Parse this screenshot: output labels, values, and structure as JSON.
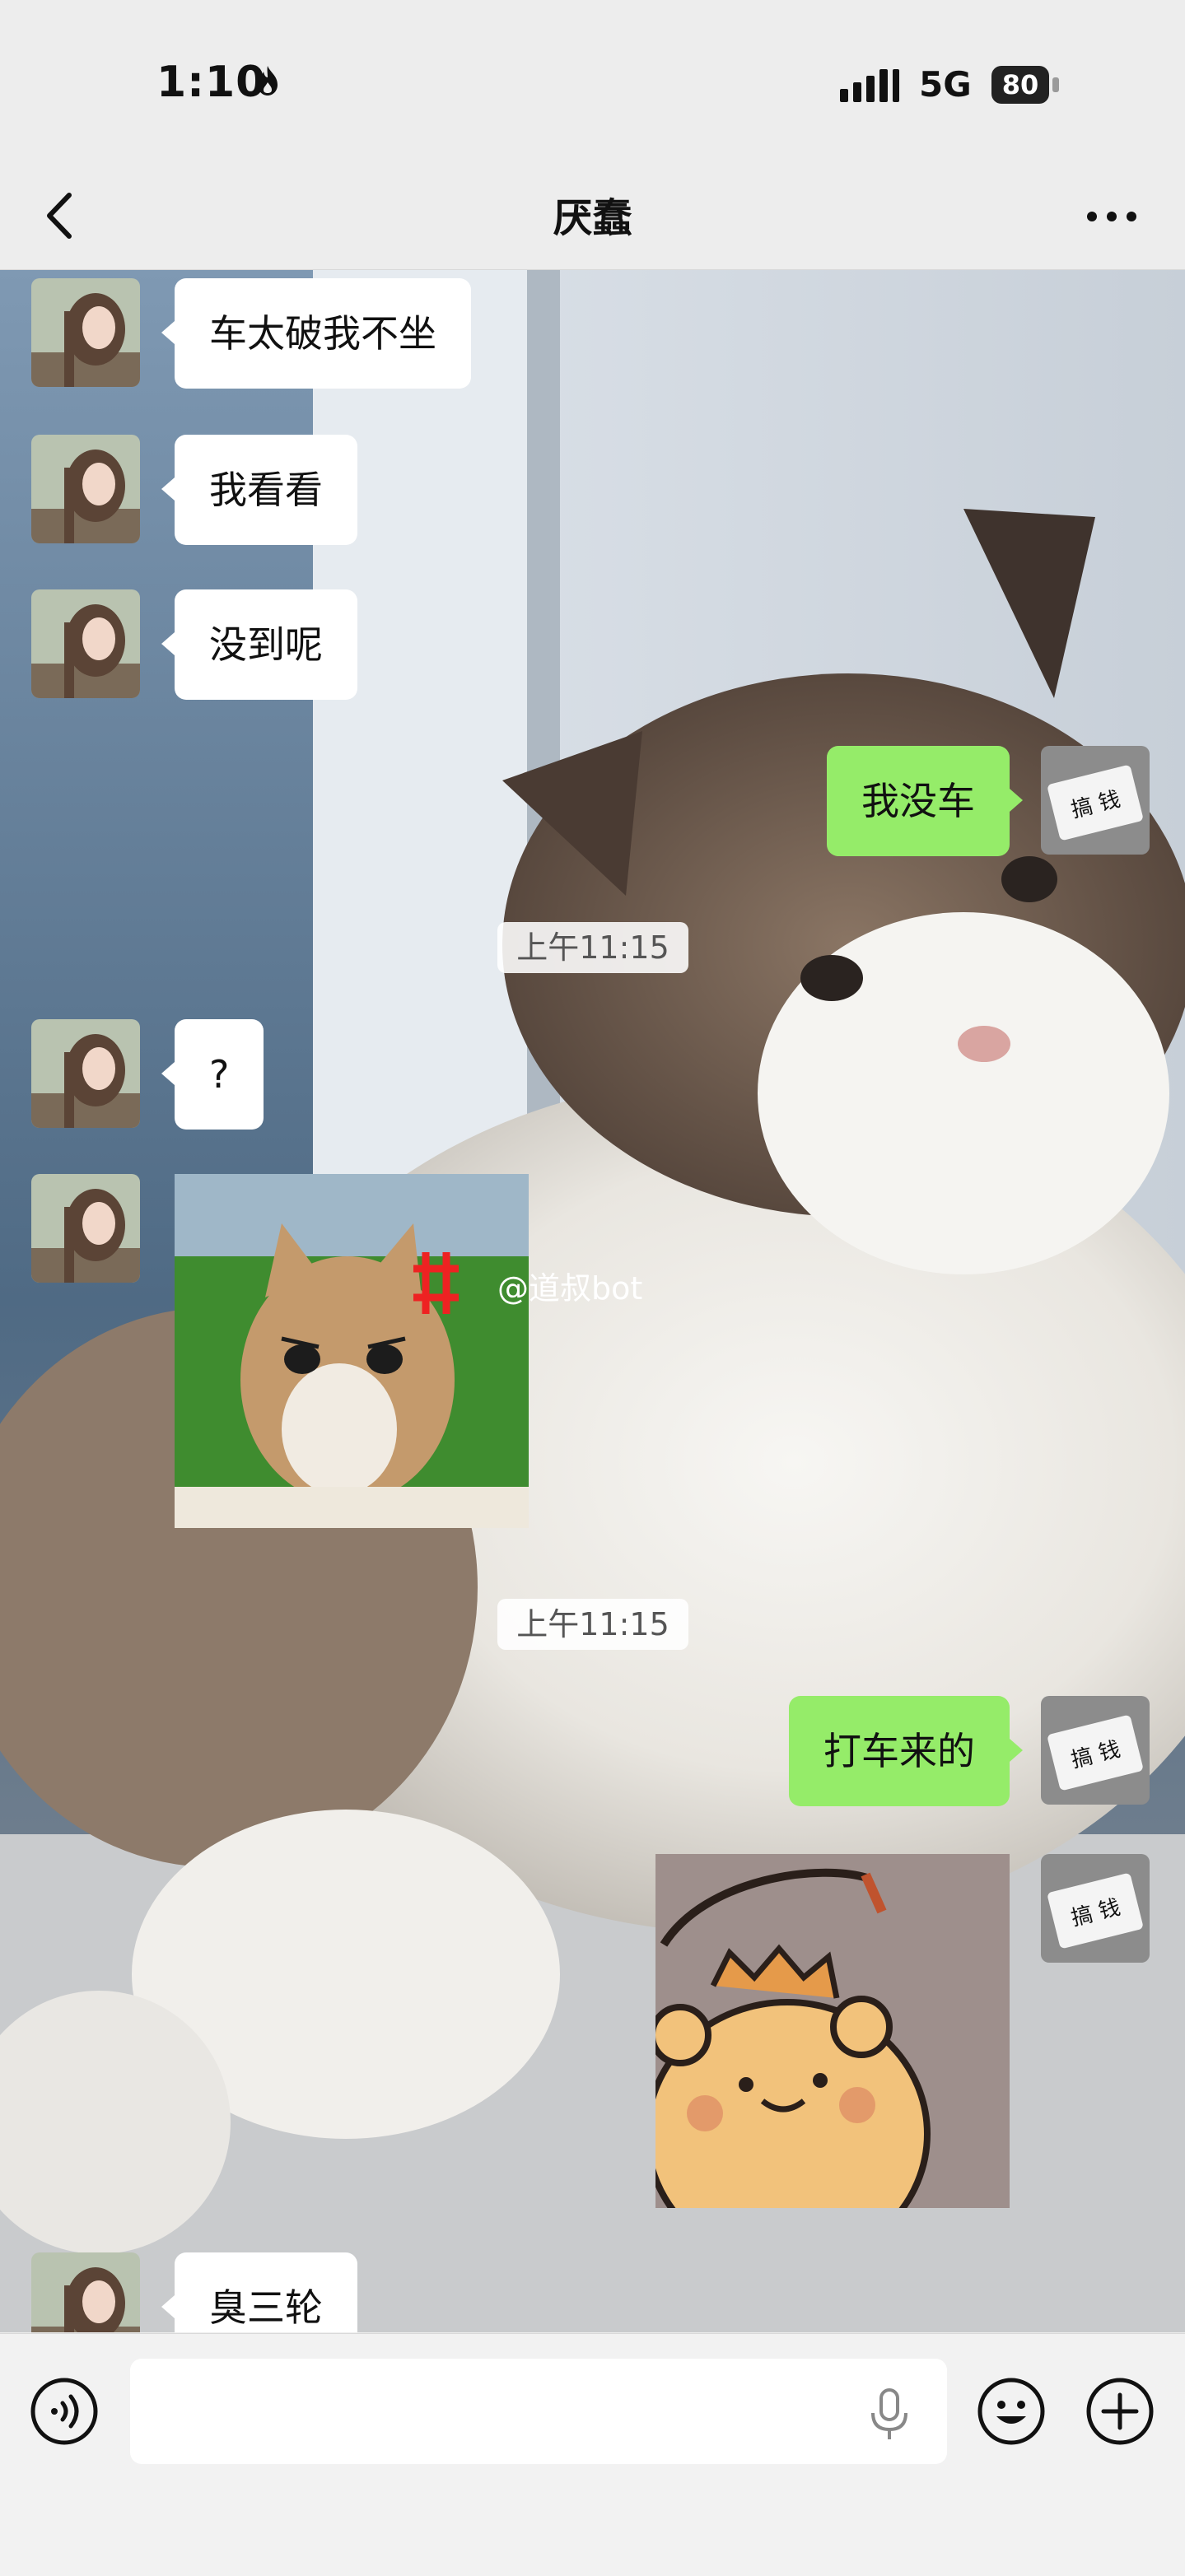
{
  "status_bar": {
    "time": "1:10",
    "network": "5G",
    "battery": "80"
  },
  "header": {
    "title": "厌蠢"
  },
  "messages": [
    {
      "side": "in",
      "text": "车太破我不坐"
    },
    {
      "side": "in",
      "text": "我看看"
    },
    {
      "side": "in",
      "text": "没到呢"
    },
    {
      "side": "out",
      "text": "我没车"
    },
    {
      "type": "time",
      "text": "上午11:15"
    },
    {
      "side": "in",
      "text": "?"
    },
    {
      "side": "in",
      "type": "sticker",
      "sticker": "angry-cat-sticker"
    },
    {
      "type": "time",
      "text": "上午11:15"
    },
    {
      "side": "out",
      "text": "打车来的"
    },
    {
      "side": "out",
      "type": "sticker",
      "sticker": "bear-sticker"
    },
    {
      "side": "in",
      "text": "臭三轮"
    }
  ],
  "watermark": "@道叔bot",
  "input": {
    "placeholder": ""
  },
  "colors": {
    "outgoing_bubble": "#95ec69",
    "incoming_bubble": "#ffffff",
    "bar_bg": "#ededed"
  }
}
